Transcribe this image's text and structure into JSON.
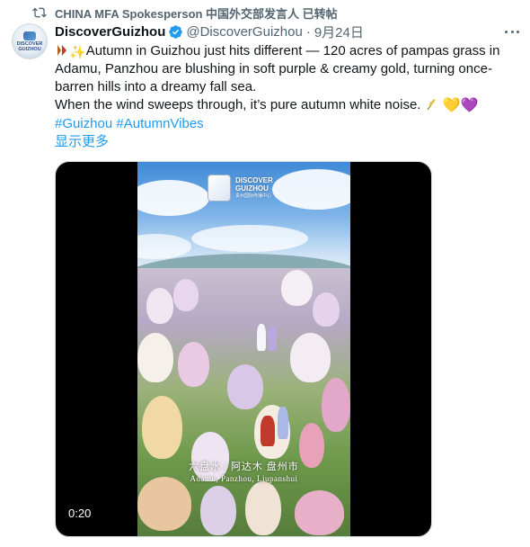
{
  "repost": {
    "label": "CHINA MFA Spokesperson 中国外交部发言人 已转帖",
    "icon": "repost-icon"
  },
  "author": {
    "avatar_text": "DISCOVER GUIZHOU",
    "name": "DiscoverGuizhou",
    "verified_icon": "verified-badge-icon",
    "handle": "@DiscoverGuizhou",
    "separator": "·",
    "date": "9月24日"
  },
  "more_icon": "more-options-icon",
  "post": {
    "line1_text": "Autumn in Guizhou just hits different — 120 acres of pampas grass in Adamu, Panzhou are blushing in soft purple & creamy gold, turning once-barren hills into a dreamy fall sea.",
    "line2_text": "When the wind sweeps through, it’s pure autumn white noise. ",
    "emoji_sparkle": "✨",
    "emoji_hearts_yellow": "💛",
    "emoji_hearts_purple": "💜",
    "hashtags": [
      "#Guizhou",
      "#AutumnVibes"
    ],
    "show_more": "显示更多"
  },
  "media": {
    "overlay_brand_line1": "DISCOVER",
    "overlay_brand_line2": "GUIZHOU",
    "overlay_brand_sub": "贵州国际传播中心",
    "caption_cn": "六盘水 | 阿达木 盘州市",
    "caption_en": "Adamu, Panzhou, Liupanshui",
    "timer": "0:20"
  },
  "colors": {
    "link": "#1d9bf0",
    "muted": "#536471",
    "text": "#0f1419",
    "verified": "#1d9bf0"
  }
}
